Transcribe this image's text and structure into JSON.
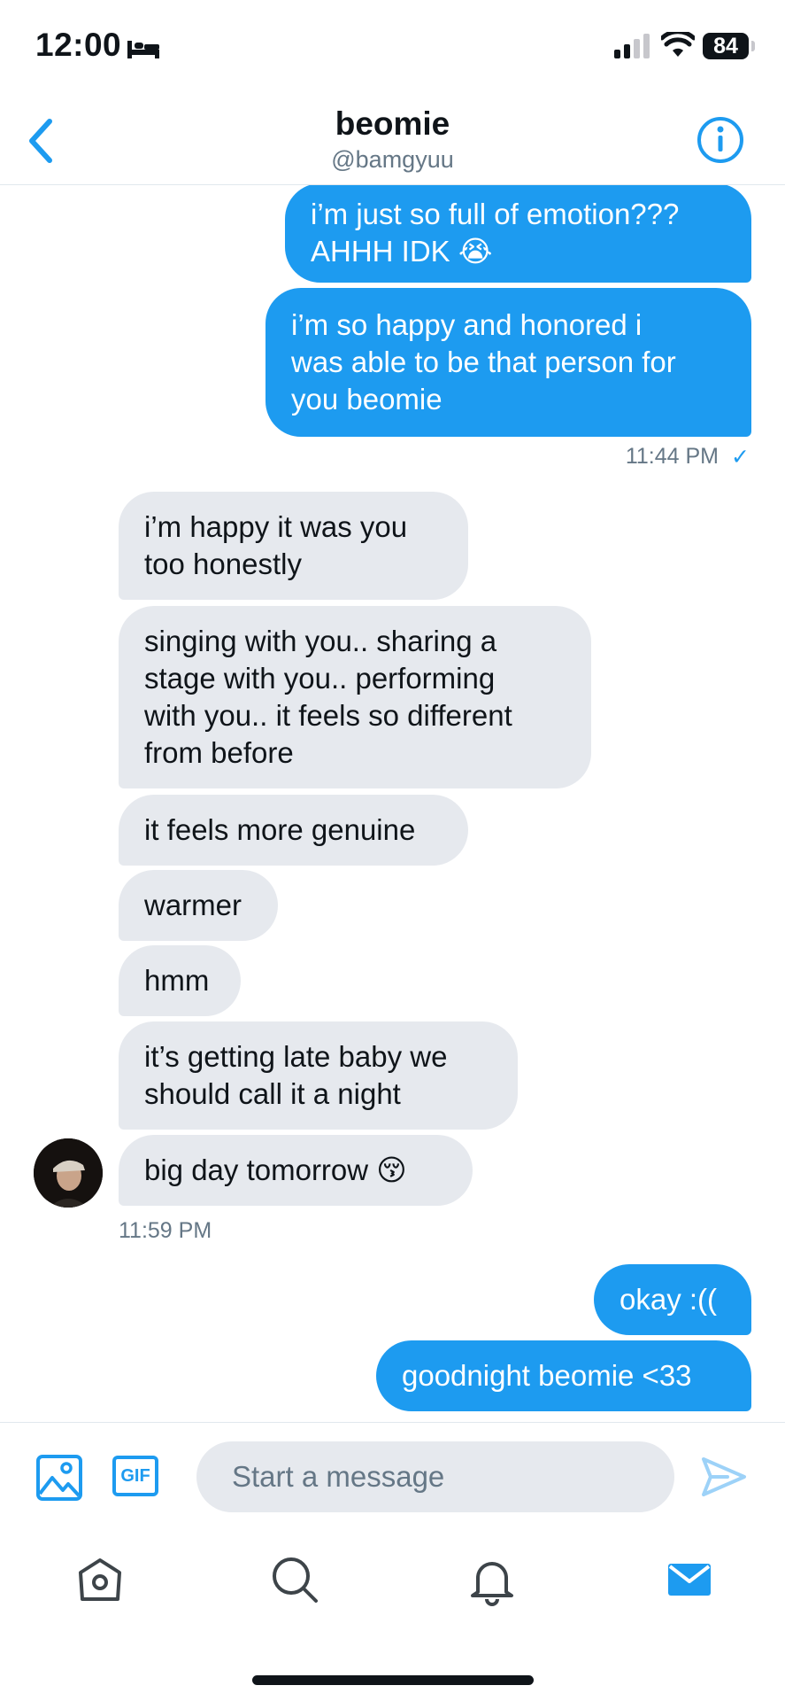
{
  "status_bar": {
    "time": "12:00",
    "battery": "84"
  },
  "header": {
    "name": "beomie",
    "handle": "@bamgyuu"
  },
  "messages": [
    {
      "dir": "out",
      "text": "i’m just so full of emotion???\nAHHH IDK 😭"
    },
    {
      "dir": "out",
      "text": "i’m so happy and honored i\nwas able to be that person for\nyou beomie"
    },
    {
      "dir": "in",
      "text": "i’m happy it was you\ntoo honestly"
    },
    {
      "dir": "in",
      "text": "singing with you.. sharing a\nstage with you.. performing\nwith you.. it feels so different\nfrom before"
    },
    {
      "dir": "in",
      "text": "it feels more genuine"
    },
    {
      "dir": "in",
      "text": "warmer"
    },
    {
      "dir": "in",
      "text": "hmm"
    },
    {
      "dir": "in",
      "text": "it’s getting late baby we\nshould call it a night"
    },
    {
      "dir": "in",
      "text": "big day tomorrow 😚"
    },
    {
      "dir": "out",
      "text": "okay :(("
    },
    {
      "dir": "out",
      "text": "goodnight beomie <33"
    }
  ],
  "timestamps": {
    "sent": "11:44 PM",
    "sent_check": "✓",
    "received": "11:59 PM"
  },
  "composer": {
    "placeholder": "Start a message",
    "gif_label": "GIF"
  },
  "colors": {
    "accent": "#1d9bf0",
    "incoming_bubble": "#e6e9ee",
    "muted_text": "#657786"
  },
  "icons": {
    "header": [
      "back-chevron-icon",
      "info-icon"
    ],
    "composer": [
      "image-icon",
      "gif-icon",
      "send-icon"
    ],
    "tabs": [
      "home-icon",
      "search-icon",
      "notifications-icon",
      "messages-icon"
    ]
  }
}
